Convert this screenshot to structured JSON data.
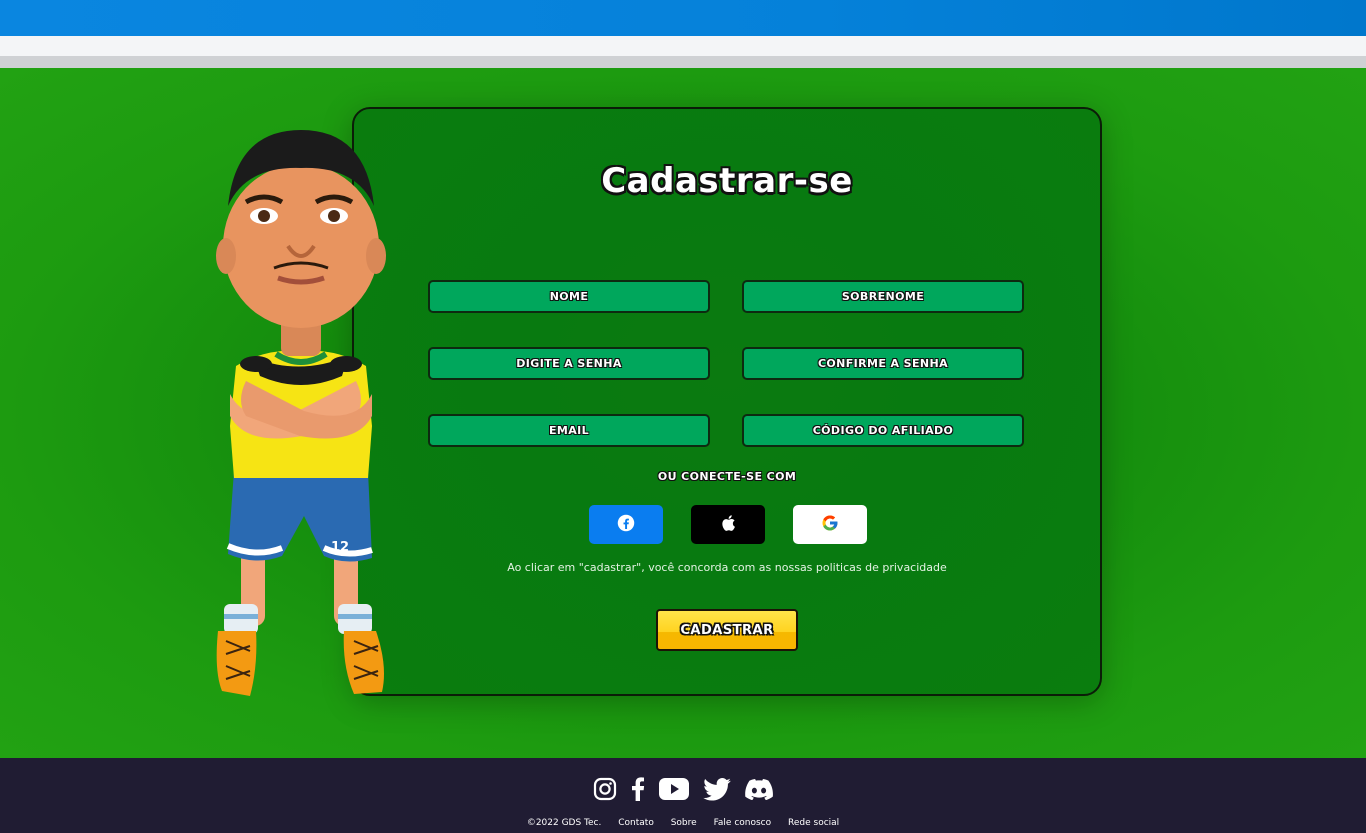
{
  "form": {
    "title": "Cadastrar-se",
    "fields": {
      "nome": "NOME",
      "sobrenome": "SOBRENOME",
      "senha": "DIGITE A SENHA",
      "confirme_senha": "CONFIRME A SENHA",
      "email": "EMAIL",
      "codigo_afiliado": "CÓDIGO DO AFILIADO"
    },
    "connect_label": "OU CONECTE-SE COM",
    "social": [
      {
        "icon": "facebook-icon",
        "color": "#0a7df0"
      },
      {
        "icon": "apple-icon",
        "color": "#000000"
      },
      {
        "icon": "google-icon",
        "color": "#ffffff"
      }
    ],
    "terms": "Ao clicar em \"cadastrar\", você concorda com as nossas politicas de privacidade",
    "submit_label": "CADASTRAR"
  },
  "footer": {
    "social_icons": [
      "instagram-icon",
      "facebook-icon",
      "youtube-icon",
      "twitter-icon",
      "discord-icon"
    ],
    "copyright": "©2022 GDS Tec.",
    "links": [
      "Contato",
      "Sobre",
      "Fale conosco",
      "Rede social"
    ]
  },
  "colors": {
    "topbar": "#0581d9",
    "field_green": "#1f9c0c",
    "input_green": "#00a75c",
    "submit_yellow": "#ffd320",
    "footer": "#201c33"
  }
}
